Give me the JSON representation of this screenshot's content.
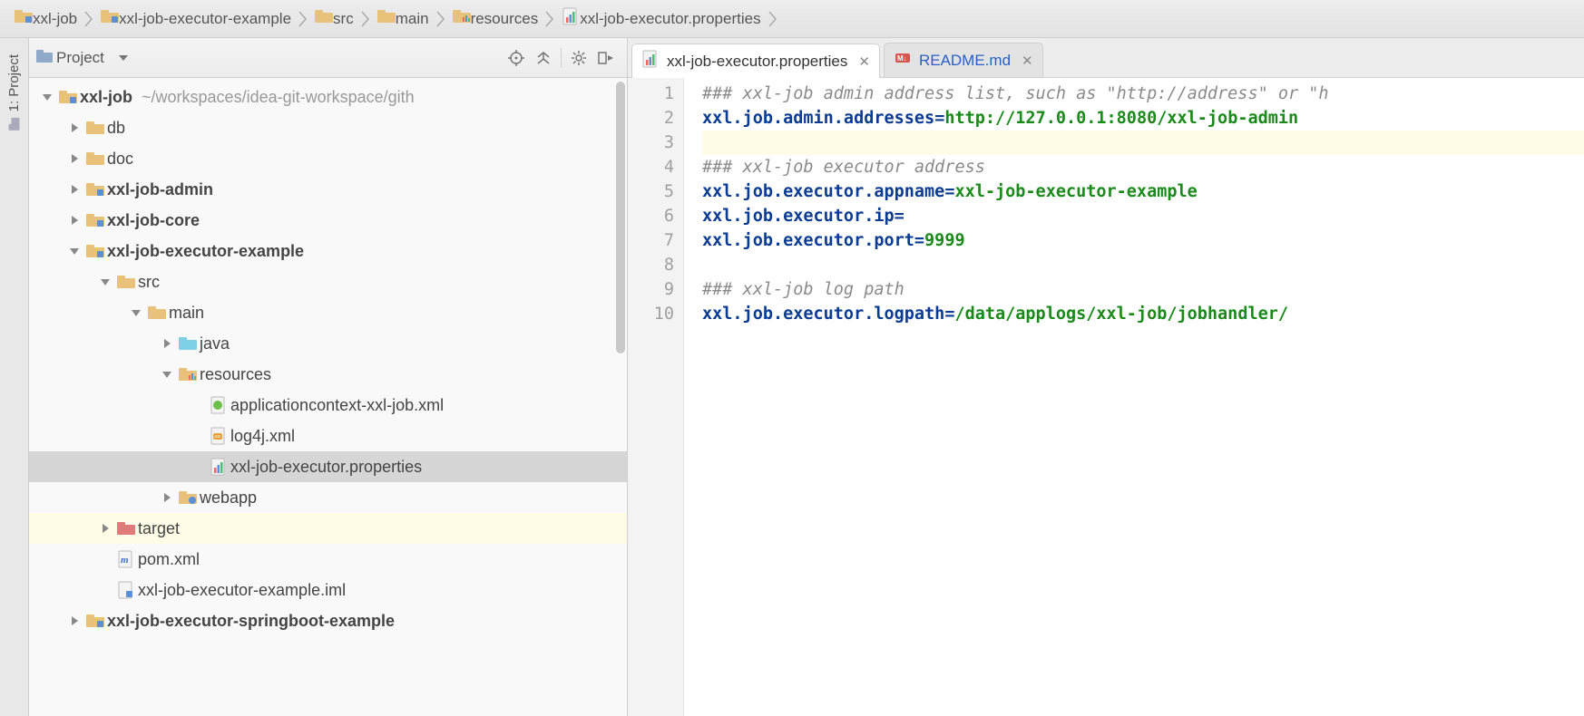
{
  "breadcrumbs": [
    {
      "label": "xxl-job",
      "icon": "module-folder"
    },
    {
      "label": "xxl-job-executor-example",
      "icon": "module-folder"
    },
    {
      "label": "src",
      "icon": "folder"
    },
    {
      "label": "main",
      "icon": "folder"
    },
    {
      "label": "resources",
      "icon": "resources-folder"
    },
    {
      "label": "xxl-job-executor.properties",
      "icon": "properties-file"
    }
  ],
  "gutter_tab": {
    "label": "1: Project"
  },
  "project_panel": {
    "title": "Project",
    "toolbar_icons": [
      "locate-icon",
      "collapse-all-icon",
      "settings-icon",
      "hide-icon"
    ]
  },
  "tree": [
    {
      "depth": 0,
      "arrow": "down",
      "icon": "module-folder",
      "name": "xxl-job",
      "bold": true,
      "suffix": "~/workspaces/idea-git-workspace/gith"
    },
    {
      "depth": 1,
      "arrow": "right",
      "icon": "folder",
      "name": "db"
    },
    {
      "depth": 1,
      "arrow": "right",
      "icon": "folder",
      "name": "doc"
    },
    {
      "depth": 1,
      "arrow": "right",
      "icon": "module-folder",
      "name": "xxl-job-admin",
      "bold": true
    },
    {
      "depth": 1,
      "arrow": "right",
      "icon": "module-folder",
      "name": "xxl-job-core",
      "bold": true
    },
    {
      "depth": 1,
      "arrow": "down",
      "icon": "module-folder",
      "name": "xxl-job-executor-example",
      "bold": true
    },
    {
      "depth": 2,
      "arrow": "down",
      "icon": "folder",
      "name": "src"
    },
    {
      "depth": 3,
      "arrow": "down",
      "icon": "folder",
      "name": "main"
    },
    {
      "depth": 4,
      "arrow": "right",
      "icon": "source-folder",
      "name": "java"
    },
    {
      "depth": 4,
      "arrow": "down",
      "icon": "resources-folder",
      "name": "resources"
    },
    {
      "depth": 5,
      "arrow": "none",
      "icon": "spring-file",
      "name": "applicationcontext-xxl-job.xml"
    },
    {
      "depth": 5,
      "arrow": "none",
      "icon": "xml-file",
      "name": "log4j.xml"
    },
    {
      "depth": 5,
      "arrow": "none",
      "icon": "properties-file",
      "name": "xxl-job-executor.properties",
      "selected": true
    },
    {
      "depth": 4,
      "arrow": "right",
      "icon": "web-folder",
      "name": "webapp"
    },
    {
      "depth": 2,
      "arrow": "right",
      "icon": "target-folder",
      "name": "target",
      "highlight": true
    },
    {
      "depth": 2,
      "arrow": "none",
      "icon": "maven-file",
      "name": "pom.xml"
    },
    {
      "depth": 2,
      "arrow": "none",
      "icon": "iml-file",
      "name": "xxl-job-executor-example.iml"
    },
    {
      "depth": 1,
      "arrow": "right",
      "icon": "module-folder",
      "name": "xxl-job-executor-springboot-example",
      "bold": true
    }
  ],
  "editor_tabs": [
    {
      "label": "xxl-job-executor.properties",
      "icon": "properties-file",
      "active": true
    },
    {
      "label": "README.md",
      "icon": "markdown-file",
      "active": false
    }
  ],
  "editor": {
    "lines": [
      {
        "n": 1,
        "segments": [
          {
            "t": "### xxl-job admin address list, such as \"http://address\" or \"h",
            "cls": "tok-comment"
          }
        ]
      },
      {
        "n": 2,
        "segments": [
          {
            "t": "xxl.job.admin.addresses",
            "cls": "tok-key"
          },
          {
            "t": "=",
            "cls": "tok-eq"
          },
          {
            "t": "http://127.0.0.1:8080/xxl-job-admin",
            "cls": "tok-val"
          }
        ]
      },
      {
        "n": 3,
        "hl": true,
        "segments": []
      },
      {
        "n": 4,
        "segments": [
          {
            "t": "### xxl-job executor address",
            "cls": "tok-comment"
          }
        ]
      },
      {
        "n": 5,
        "segments": [
          {
            "t": "xxl.job.executor.appname",
            "cls": "tok-key"
          },
          {
            "t": "=",
            "cls": "tok-eq"
          },
          {
            "t": "xxl-job-executor-example",
            "cls": "tok-val"
          }
        ]
      },
      {
        "n": 6,
        "segments": [
          {
            "t": "xxl.job.executor.ip",
            "cls": "tok-key"
          },
          {
            "t": "=",
            "cls": "tok-eq"
          }
        ]
      },
      {
        "n": 7,
        "segments": [
          {
            "t": "xxl.job.executor.port",
            "cls": "tok-key"
          },
          {
            "t": "=",
            "cls": "tok-eq"
          },
          {
            "t": "9999",
            "cls": "tok-val"
          }
        ]
      },
      {
        "n": 8,
        "segments": []
      },
      {
        "n": 9,
        "segments": [
          {
            "t": "### xxl-job log path",
            "cls": "tok-comment"
          }
        ]
      },
      {
        "n": 10,
        "segments": [
          {
            "t": "xxl.job.executor.logpath",
            "cls": "tok-key"
          },
          {
            "t": "=",
            "cls": "tok-eq"
          },
          {
            "t": "/data/applogs/xxl-job/jobhandler/",
            "cls": "tok-val"
          }
        ]
      }
    ]
  }
}
